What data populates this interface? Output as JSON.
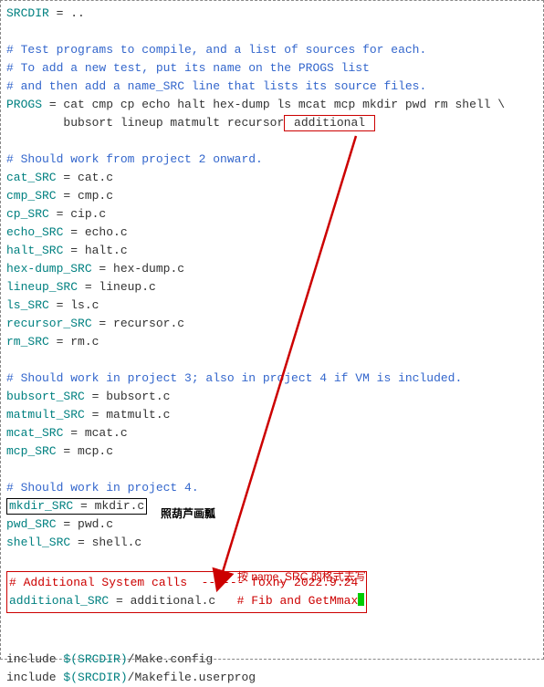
{
  "l1_var": "SRCDIR",
  "l1_rest": " = ..",
  "c1": "# Test programs to compile, and a list of sources for each.",
  "c2": "# To add a new test, put its name on the PROGS list",
  "c3": "# and then add a name_SRC line that lists its source files.",
  "progs_var": "PROGS",
  "progs_rest": " = cat cmp cp echo halt hex-dump ls mcat mcp mkdir pwd rm shell \\",
  "progs2": "        bubsort lineup matmult recursor",
  "progs2_box": " additional ",
  "c4": "# Should work from project 2 onward.",
  "s1v": "cat_SRC",
  "s1r": " = cat.c",
  "s2v": "cmp_SRC",
  "s2r": " = cmp.c",
  "s3v": "cp_SRC",
  "s3r": " = cip.c",
  "s4v": "echo_SRC",
  "s4r": " = echo.c",
  "s5v": "halt_SRC",
  "s5r": " = halt.c",
  "s6v": "hex-dump_SRC",
  "s6r": " = hex-dump.c",
  "s7v": "lineup_SRC",
  "s7r": " = lineup.c",
  "s8v": "ls_SRC",
  "s8r": " = ls.c",
  "s9v": "recursor_SRC",
  "s9r": " = recursor.c",
  "s10v": "rm_SRC",
  "s10r": " = rm.c",
  "c5": "# Should work in project 3; also in project 4 if VM is included.",
  "s11v": "bubsort_SRC",
  "s11r": " = bubsort.c",
  "s12v": "matmult_SRC",
  "s12r": " = matmult.c",
  "s13v": "mcat_SRC",
  "s13r": " = mcat.c",
  "s14v": "mcp_SRC",
  "s14r": " = mcp.c",
  "c6": "# Should work in project 4.",
  "s15full": "mkdir_SRC = mkdir.c",
  "s16v": "pwd_SRC",
  "s16r": " = pwd.c",
  "s17v": "shell_SRC",
  "s17r": " = shell.c",
  "red1": "# Additional System calls  ------ foxny 2022.9.24",
  "red2a": "additional_SRC",
  "red2b": " = additional.c   ",
  "red2c": "# Fib and GetMmax",
  "inc1a": "include ",
  "inc1b": "$(SRCDIR)",
  "inc1c": "/Make.config",
  "inc2a": "include ",
  "inc2b": "$(SRCDIR)",
  "inc2c": "/Makefile.userprog",
  "ann1": "照葫芦画瓢",
  "ann2": "按 name_SRC 的格式去写"
}
